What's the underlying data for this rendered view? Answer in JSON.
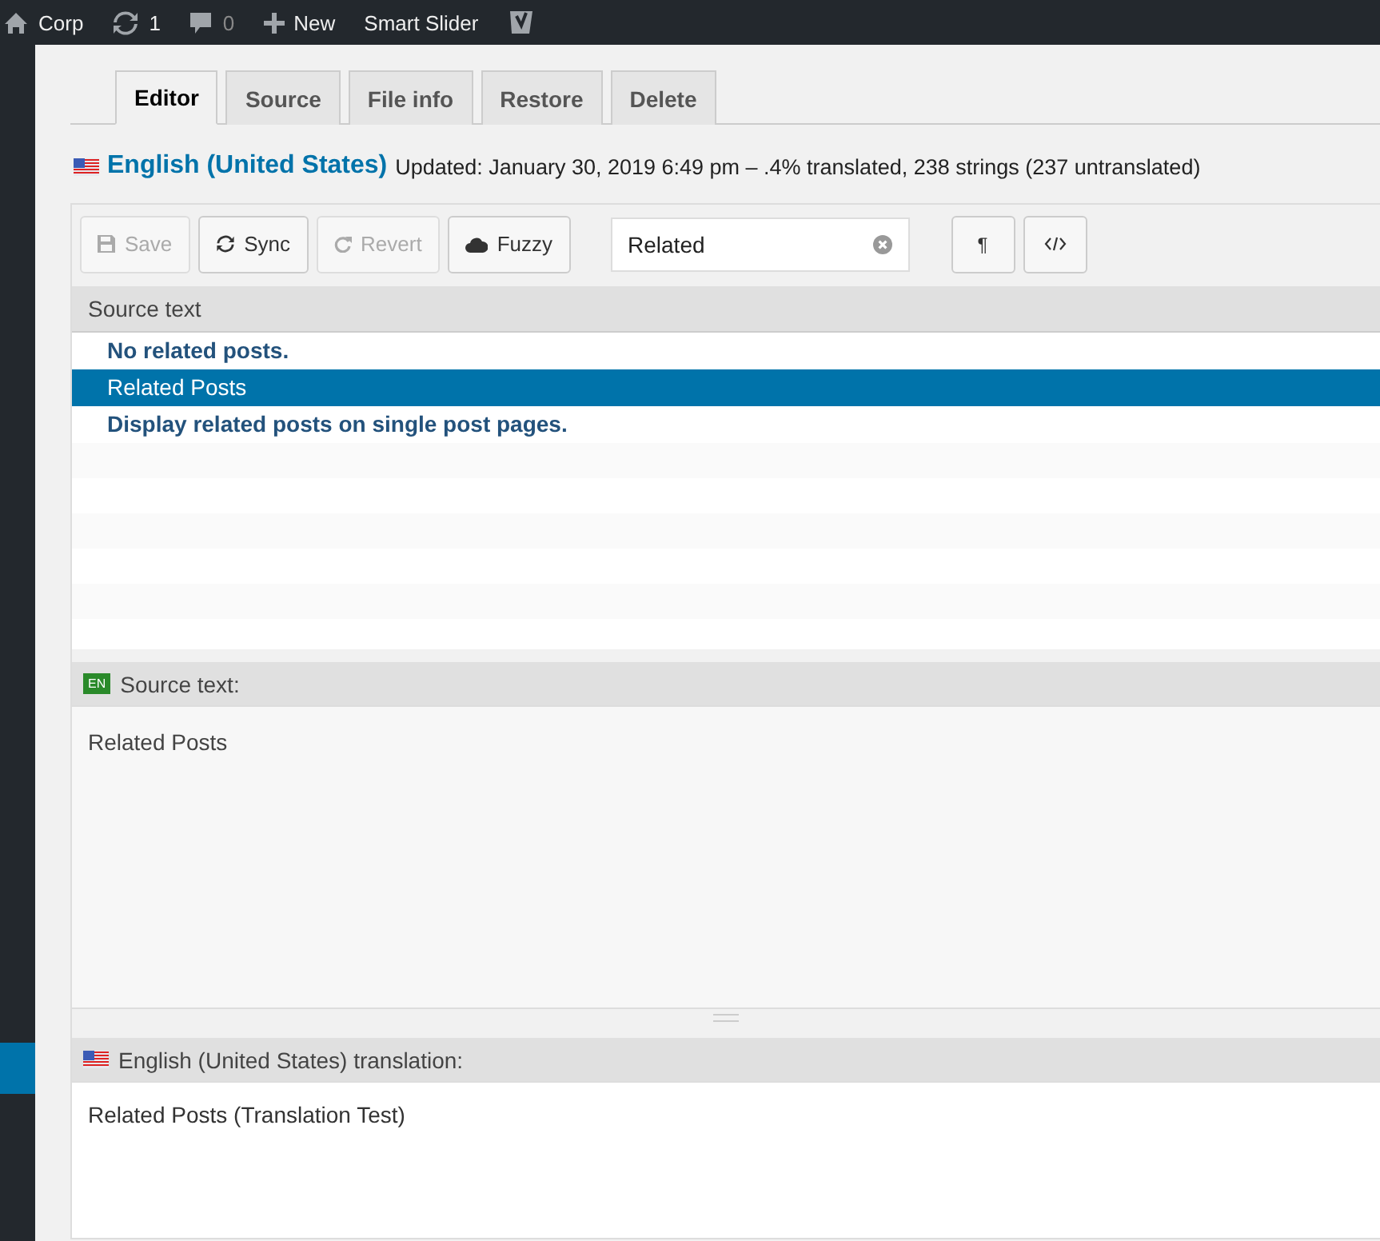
{
  "admin_bar": {
    "site": "Corp",
    "updates": "1",
    "comments": "0",
    "new": "New",
    "plugin": "Smart Slider"
  },
  "tabs": [
    {
      "label": "Editor",
      "selected": true
    },
    {
      "label": "Source",
      "selected": false
    },
    {
      "label": "File info",
      "selected": false
    },
    {
      "label": "Restore",
      "selected": false
    },
    {
      "label": "Delete",
      "selected": false
    }
  ],
  "header": {
    "language": "English (United States)",
    "status": "Updated: January 30, 2019 6:49 pm – .4% translated, 238 strings (237 untranslated)"
  },
  "toolbar": {
    "buttons": [
      {
        "kind": "save",
        "label": "Save",
        "disabled": true
      },
      {
        "kind": "sync",
        "label": "Sync",
        "disabled": false
      },
      {
        "kind": "revert",
        "label": "Revert",
        "disabled": true
      },
      {
        "kind": "fuzzy",
        "label": "Fuzzy",
        "disabled": false
      }
    ],
    "search": {
      "value": "Related"
    },
    "pilcrow": "¶"
  },
  "list": {
    "column": "Source text",
    "rows": [
      {
        "text": "No related posts.",
        "translated": false,
        "selected": false
      },
      {
        "text": "Related Posts",
        "translated": true,
        "selected": true
      },
      {
        "text": "Display related posts on single post pages.",
        "translated": false,
        "selected": false
      }
    ]
  },
  "source": {
    "badge": "EN",
    "label": "Source text:",
    "text": "Related Posts"
  },
  "translation": {
    "label": "English (United States) translation:",
    "text": "Related Posts (Translation Test)"
  }
}
